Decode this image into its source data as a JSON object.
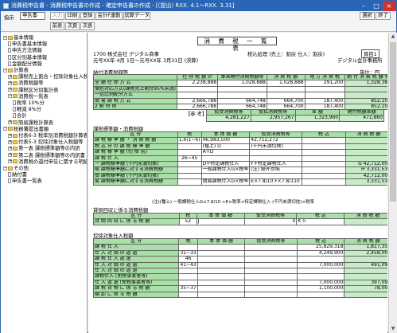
{
  "window": {
    "title": "消費税申告書 - 消費税申告書の作成 - 確定申告書の作成 - [(提出) RXX. 4.1～RXX. 3.31]",
    "min": "–",
    "max": "□",
    "close": "×"
  },
  "toolbar": {
    "label": "指示",
    "select": "申告書",
    "buttons": [
      "入力",
      "印刷",
      "登録",
      "会計F連動",
      "試算データ"
    ],
    "right": [
      "選択",
      "終了"
    ],
    "nav": [
      "前表",
      "次頁",
      "次表"
    ]
  },
  "tree": [
    {
      "t": "基本情報",
      "lv": 0,
      "k": "minus"
    },
    {
      "t": "申告書基本情報",
      "lv": 1,
      "k": "page"
    },
    {
      "t": "申告方法情報",
      "lv": 1,
      "k": "page"
    },
    {
      "t": "区分別基本情報",
      "lv": 1,
      "k": "page"
    },
    {
      "t": "金額配分情報",
      "lv": 1,
      "k": "page"
    },
    {
      "t": "計算表",
      "lv": 0,
      "k": "minus"
    },
    {
      "t": "課税売上割合・控除対象仕入税額等",
      "lv": 1,
      "k": "plus"
    },
    {
      "t": "消費税額等",
      "lv": 1,
      "k": "plus"
    },
    {
      "t": "課税区分別集計表",
      "lv": 1,
      "k": "plus"
    },
    {
      "t": "消費税一覧表",
      "lv": 1,
      "k": "minus"
    },
    {
      "t": "税率 10%分",
      "lv": 2,
      "k": "page"
    },
    {
      "t": "軽減 8%分",
      "lv": 2,
      "k": "page"
    },
    {
      "t": "合計",
      "lv": 2,
      "k": "page"
    },
    {
      "t": "簡易課税計算表",
      "lv": 1,
      "k": "plus"
    },
    {
      "t": "税務署提出書類",
      "lv": 0,
      "k": "minus"
    },
    {
      "t": "付表6-3 税率別消費税額計算表",
      "lv": 1,
      "k": "plus"
    },
    {
      "t": "付表5-3 控除対象仕入税額等",
      "lv": 1,
      "k": "plus"
    },
    {
      "t": "第一表 課税標準額等の内訳",
      "lv": 1,
      "k": "plus"
    },
    {
      "t": "第二表 課税標準額等の内訳書",
      "lv": 1,
      "k": "plus"
    },
    {
      "t": "消費税の還付申告に関する明細書",
      "lv": 1,
      "k": "plus"
    },
    {
      "t": "その他",
      "lv": 0,
      "k": "minus"
    },
    {
      "t": "納付書",
      "lv": 1,
      "k": "page"
    },
    {
      "t": "申告書一覧表",
      "lv": 1,
      "k": "page"
    }
  ],
  "doc": {
    "title": "消 費 税 一 覧 表",
    "company": "1700 株式会社 デジタル商事",
    "period": "元号ⅩⅩ年 4月 1日～元号ⅩⅩ年 3月31日 (決算)",
    "method": "税込処理 (売上：割戻 仕入：割戻)",
    "page_label": "頁目",
    "page_no": "1",
    "vendor": "デジタル会計事務所",
    "unit": "単位：円",
    "sec1": "納付消費税額等",
    "top_headers": [
      "控 除 税 額 計",
      "本来納付消費税額等",
      "消 費 税 額",
      "地 方 消 費 税",
      "納 付 消 費 税 額 等"
    ],
    "top_rows": [
      {
        "l": "全 額 控 除 方 式",
        "v": [
          "2,238,888",
          "1,028,888",
          "1,028,888",
          "291,200",
          "1,328,388"
        ]
      },
      {
        "l": "個別対応方式(課税売上割合95%未満)",
        "v": [
          "",
          "",
          "",
          "",
          ""
        ]
      },
      {
        "l": "一括比例配分方式",
        "v": [
          "",
          "",
          "",
          "",
          ""
        ]
      },
      {
        "l": "簡 易 課 税 方 式",
        "v": [
          "2,666,788",
          "664,748",
          "664,700",
          "187,400",
          "852,100"
        ]
      },
      {
        "l": "2 割 特 例",
        "v": [
          "2,666,788",
          "664,748",
          "664,700",
          "187,400",
          "852,100"
        ]
      }
    ],
    "ref_label": "【参 考】",
    "ref_headers": [
      "仮受消費税等",
      "仮払消費税等",
      "差 額",
      "納付税額差額"
    ],
    "ref_values": [
      "4,281,227",
      "2,957,267",
      "1,323,960",
      "471,860"
    ],
    "sec2": "課税標準額・消費税額",
    "h2": [
      "区 分",
      "税",
      "本 体 価 額",
      "仮受消費税等",
      "税 込",
      "消 費 税 額"
    ],
    "rows2": [
      {
        "l": "課 税 標 準 額 ・ 消 費 税 額",
        "k": "1,6(1~6)",
        "a": "46,983,500",
        "b": "42,712,272",
        "m": "D"
      },
      {
        "l": "税 込 分 の 課 税 標 準 額",
        "k": "",
        "a": "(種上) D",
        "b": "(千円未満切捨)",
        "m": ""
      },
      {
        "l": "課 税 標 準 額 (切 捨 前)",
        "k": "",
        "a": "A+D",
        "b": "",
        "m": ""
      },
      {
        "l": "課 税 仕 入",
        "k": "26~45",
        "a": "",
        "b": "",
        "m": ""
      },
      {
        "l": "一 課税標準額 (千円未満切捨)",
        "k": "",
        "a": "D+特定課税仕入",
        "b": "F+特定課税仕入",
        "m": "G 42,712,000"
      },
      {
        "l": "般 課税標準額に対する消費税額",
        "k": "",
        "a": "一般課税仕入G×税率",
        "b": "(注) 経外参照",
        "m": "H 3,331,536"
      },
      {
        "l": "簡 課税標準額 (千円未満切捨)",
        "k": "",
        "a": "",
        "b": "",
        "m": "42,712,000"
      },
      {
        "l": "易 課税標準額に対する消費税額",
        "k": "",
        "a": "簡易課税仕入G×税率",
        "b": "E×7.8/10 F×7.8/110",
        "m": "3,331,536"
      }
    ],
    "note2": "(注)(種上) 一般課税仕入G×7.8/10 +E×税率+特定課税仕入 (千円未満切捨)×税率",
    "sec3": "貸倒回収に係る消費税額",
    "h3": [
      "区 分",
      "税",
      "本 体 価 額",
      "仮受消費税等",
      "税 込",
      "消 費 税 額"
    ],
    "rows3": [
      {
        "l": "貸 倒 回 収 に 係 る 税 額",
        "k": "52",
        "a": "J",
        "b": "0",
        "c": "K 0",
        "m": "L"
      }
    ],
    "sec4": "控除対象仕入税額",
    "h4": [
      "区 分",
      "税",
      "本 体 価 額",
      "仮受消費税等",
      "税 込",
      "消 費 税 額"
    ],
    "rows4": [
      {
        "l": "課 税 仕 入",
        "k": "",
        "a": "",
        "b": "25,829,318",
        "m": "1,817,351"
      },
      {
        "l": "仕 入 対 価 の 返 還",
        "k": "31~33",
        "a": "",
        "b": "4,249,900",
        "m": "2,458,000"
      },
      {
        "l": "課 税 仕 入 返 還",
        "k": "46",
        "a": "",
        "b": "",
        "m": "0"
      },
      {
        "l": "仕 入 対 価 の 返 還",
        "k": "41~43",
        "a": "",
        "b": "7,000,000",
        "m": "491,090"
      },
      {
        "l": "仕 入 対 価 の 返 還",
        "k": "",
        "a": "",
        "b": "",
        "m": "0"
      },
      {
        "l": "課税仕入 (免税事業者等)",
        "k": "",
        "a": "",
        "b": "",
        "m": ""
      },
      {
        "l": "仕 入 返 還 (免税事業者等)",
        "k": "",
        "a": "",
        "b": "7,000,000",
        "m": "397,090"
      },
      {
        "l": "課 税 貨 物 に 係 る 税 額",
        "k": "35~37",
        "a": "",
        "b": "1,100,000",
        "m": "78,000"
      },
      {
        "l": "棚 卸 に 係 る 税 額",
        "k": "",
        "a": "",
        "b": "",
        "m": ""
      }
    ]
  }
}
